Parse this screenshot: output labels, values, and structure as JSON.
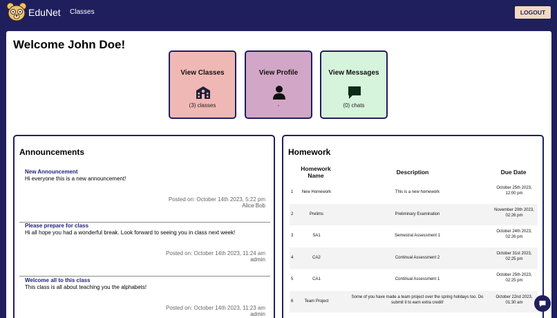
{
  "nav": {
    "brand": "EduNet",
    "classes_link": "Classes",
    "logout_label": "LOGOUT"
  },
  "welcome": "Welcome John Doe!",
  "cards": {
    "classes": {
      "title": "View Classes",
      "sub": "(3) classes",
      "icon": "school-icon"
    },
    "profile": {
      "title": "View Profile",
      "sub": "-",
      "icon": "user-icon"
    },
    "messages": {
      "title": "View Messages",
      "sub": "(0) chats",
      "icon": "chat-bubble-icon"
    }
  },
  "announcements": {
    "title": "Announcements",
    "items": [
      {
        "title": "New Announcement",
        "body": "Hi everyone this is a new announcement!",
        "posted": "Posted on: October 14th 2023, 5:22 pm",
        "author": "Alice Bob"
      },
      {
        "title": "Please prepare for class",
        "body": "Hi all hope you had a wonderful break. Look forward to seeing you in class next week!",
        "posted": "Posted on: October 14th 2023, 11:24 am",
        "author": "admin"
      },
      {
        "title": "Welcome all to this class",
        "body": "This class is all about teaching you the alphabets!",
        "posted": "Posted on: October 14th 2023, 11:23 am",
        "author": "admin"
      }
    ]
  },
  "homework": {
    "title": "Homework",
    "columns": {
      "name_line1": "Homework",
      "name_line2": "Name",
      "description": "Description",
      "due": "Due Date"
    },
    "rows": [
      {
        "num": "1",
        "name": "New Homework",
        "description": "This is a new homework",
        "due_date": "October 25th 2023,",
        "due_time": "12:00 pm"
      },
      {
        "num": "2",
        "name": "Prelims",
        "description": "Preliminary Examination",
        "due_date": "November 20th 2023,",
        "due_time": "02:26 pm"
      },
      {
        "num": "3",
        "name": "SA1",
        "description": "Semestral Assessment 1",
        "due_date": "October 24th 2023,",
        "due_time": "02:26 pm"
      },
      {
        "num": "4",
        "name": "CA2",
        "description": "Continual Assessment 2",
        "due_date": "October 31st 2023,",
        "due_time": "02:25 pm"
      },
      {
        "num": "5",
        "name": "CA1",
        "description": "Continual Assessment 1",
        "due_date": "October 25th 2023,",
        "due_time": "02:25 pm"
      },
      {
        "num": "6",
        "name": "Team Project",
        "description_line1": "Some of you have made a team project over the spring holidays too. Do",
        "description_line2": "submit it to earn extra credit!",
        "due_date": "October 22nd 2023,",
        "due_time": "01:30 am"
      }
    ]
  },
  "colors": {
    "navy": "#1f1f5e",
    "logout_bg": "#f3d9bf",
    "card_classes": "#efb8b4",
    "card_profile": "#d2a6c6",
    "card_messages": "#d6f3dc"
  }
}
